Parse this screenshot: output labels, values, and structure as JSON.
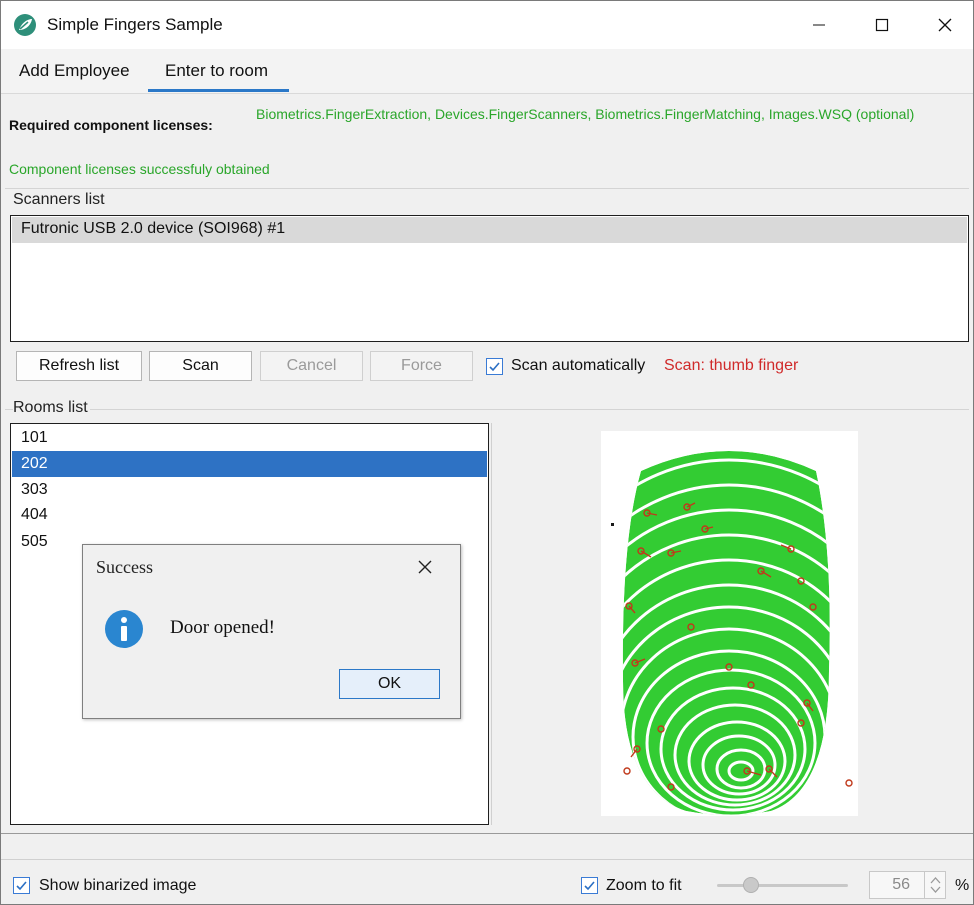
{
  "window": {
    "title": "Simple Fingers Sample",
    "icon": "app-leaf-icon"
  },
  "tabs": [
    {
      "label": "Add Employee",
      "active": false
    },
    {
      "label": "Enter to room",
      "active": true
    }
  ],
  "licenses": {
    "label": "Required component licenses:",
    "list": "Biometrics.FingerExtraction, Devices.FingerScanners, Biometrics.FingerMatching, Images.WSQ (optional)",
    "status": "Component licenses successfuly obtained",
    "color": "#2aa62a"
  },
  "scanners": {
    "group_title": "Scanners list",
    "items": [
      "Futronic USB 2.0 device (SOI968) #1"
    ],
    "selected_index": 0
  },
  "scan_controls": {
    "refresh": "Refresh list",
    "scan": "Scan",
    "cancel": "Cancel",
    "force": "Force",
    "auto_label": "Scan automatically",
    "auto_checked": true,
    "hint": "Scan: thumb finger",
    "hint_color": "#d02a2a"
  },
  "rooms": {
    "group_title": "Rooms list",
    "items": [
      "101",
      "202",
      "303",
      "404",
      "505"
    ],
    "selected_index": 1
  },
  "dialog": {
    "title": "Success",
    "message": "Door opened!",
    "ok": "OK",
    "icon": "info-icon"
  },
  "bottom": {
    "binarized_label": "Show binarized image",
    "binarized_checked": true,
    "zoom_label": "Zoom to fit",
    "zoom_checked": true,
    "zoom_value": "56",
    "zoom_unit": "%"
  },
  "colors": {
    "accent": "#2b78c8",
    "selection": "#2e72c4",
    "fingerprint": "#33cc33",
    "minutiae": "#c0391b"
  }
}
